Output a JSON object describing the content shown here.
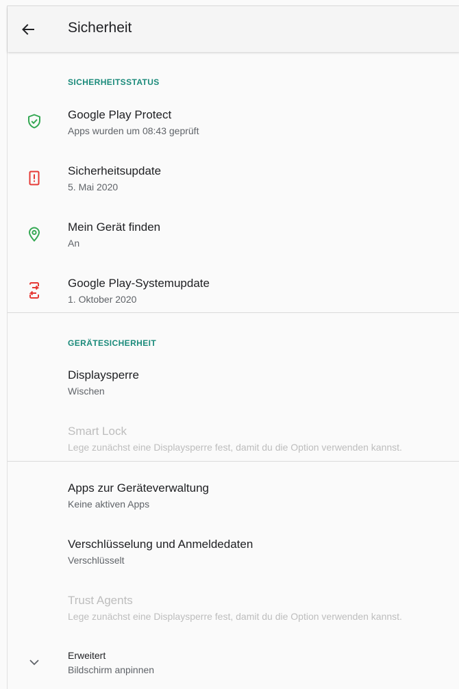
{
  "appbar": {
    "title": "Sicherheit"
  },
  "sections": {
    "security_status": "SICHERHEITSSTATUS",
    "device_security": "GERÄTESICHERHEIT"
  },
  "items": {
    "play_protect": {
      "title": "Google Play Protect",
      "summary": "Apps wurden um 08:43 geprüft",
      "icon": "shield-check-icon",
      "color": "#34a853"
    },
    "security_update": {
      "title": "Sicherheitsupdate",
      "summary": "5. Mai 2020",
      "icon": "phone-alert-icon",
      "color": "#e53935"
    },
    "find_device": {
      "title": "Mein Gerät finden",
      "summary": "An",
      "icon": "location-pin-icon",
      "color": "#34a853"
    },
    "play_system_update": {
      "title": "Google Play-Systemupdate",
      "summary": "1. Oktober 2020",
      "icon": "phone-update-icon",
      "color": "#e53935"
    },
    "screen_lock": {
      "title": "Displaysperre",
      "summary": "Wischen"
    },
    "smart_lock": {
      "title": "Smart Lock",
      "summary": "Lege zunächst eine Displaysperre fest, damit du die Option verwenden kannst."
    },
    "device_admin_apps": {
      "title": "Apps zur Geräteverwaltung",
      "summary": "Keine aktiven Apps"
    },
    "encryption": {
      "title": "Verschlüsselung und Anmeldedaten",
      "summary": "Verschlüsselt"
    },
    "trust_agents": {
      "title": "Trust Agents",
      "summary": "Lege zunächst eine Displaysperre fest, damit du die Option verwenden kannst."
    },
    "advanced": {
      "title": "Erweitert",
      "summary": "Bildschirm anpinnen"
    }
  }
}
